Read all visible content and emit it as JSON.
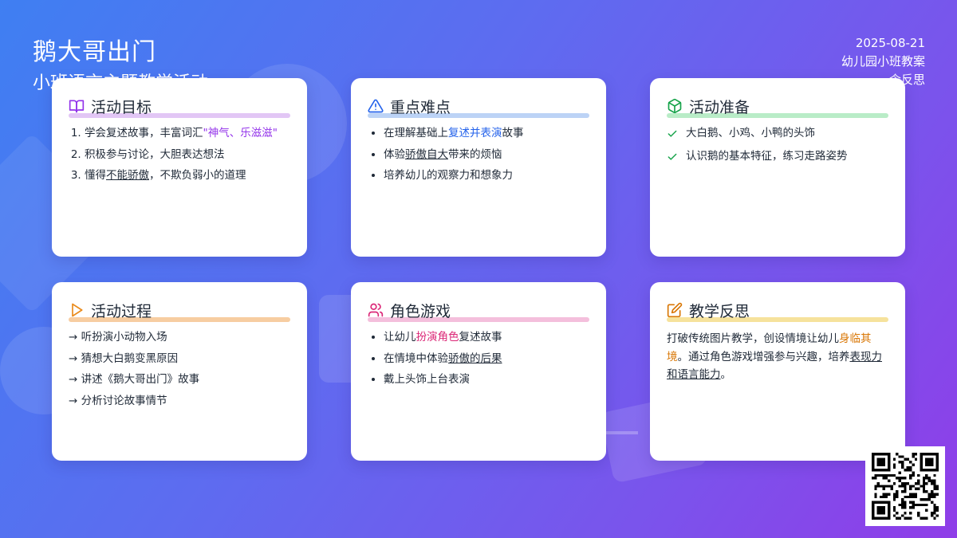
{
  "header": {
    "title": "鹅大哥出门",
    "subtitle": "小班语言主题教学活动",
    "date": "2025-08-21",
    "category": "幼儿园小班教案",
    "reflection": "含反思"
  },
  "colors": {
    "purple": "#9333ea",
    "blue": "#2563eb",
    "green": "#16a34a",
    "orange": "#ea8a1a",
    "pink": "#db2777",
    "yellow": "#d97706"
  },
  "cards": {
    "goals": {
      "title": "活动目标",
      "icon": "book-open-icon",
      "items": [
        {
          "pre": "学会复述故事，丰富词汇",
          "hl": "\"神气、乐滋滋\"",
          "post": ""
        },
        {
          "pre": "积极参与讨论，大胆表达想法",
          "hl": "",
          "post": ""
        },
        {
          "pre": "懂得",
          "hl": "不能骄傲",
          "post": "，不欺负弱小的道理"
        }
      ]
    },
    "keypoints": {
      "title": "重点难点",
      "icon": "warning-triangle-icon",
      "items": [
        {
          "pre": "在理解基础上",
          "hl": "复述并表演",
          "post": "故事"
        },
        {
          "pre": "体验",
          "hl": "骄傲自大",
          "post": "带来的烦恼"
        },
        {
          "pre": "培养幼儿的观察力和想象力",
          "hl": "",
          "post": ""
        }
      ]
    },
    "prep": {
      "title": "活动准备",
      "icon": "package-box-icon",
      "items": [
        "大白鹅、小鸡、小鸭的头饰",
        "认识鹅的基本特征，练习走路姿势"
      ]
    },
    "process": {
      "title": "活动过程",
      "icon": "play-triangle-icon",
      "items": [
        "→ 听扮演小动物入场",
        "→ 猜想大白鹅变黑原因",
        "→ 讲述《鹅大哥出门》故事",
        "→ 分析讨论故事情节"
      ]
    },
    "roleplay": {
      "title": "角色游戏",
      "icon": "users-icon",
      "items": [
        {
          "pre": "让幼儿",
          "hl": "扮演角色",
          "post": "复述故事"
        },
        {
          "pre": "在情境中体验",
          "hl": "骄傲的后果",
          "post": ""
        },
        {
          "pre": "戴上头饰上台表演",
          "hl": "",
          "post": ""
        }
      ]
    },
    "reflection": {
      "title": "教学反思",
      "icon": "edit-pencil-icon",
      "p1": "打破传统图片教学，创设情境让幼儿",
      "hl1": "身临其境",
      "p2": "。通过角色游戏增强参与兴趣，培养",
      "hl2": "表现力和语言能力",
      "p3": "。"
    }
  },
  "qr_code": {
    "icon": "qr-code-icon"
  }
}
